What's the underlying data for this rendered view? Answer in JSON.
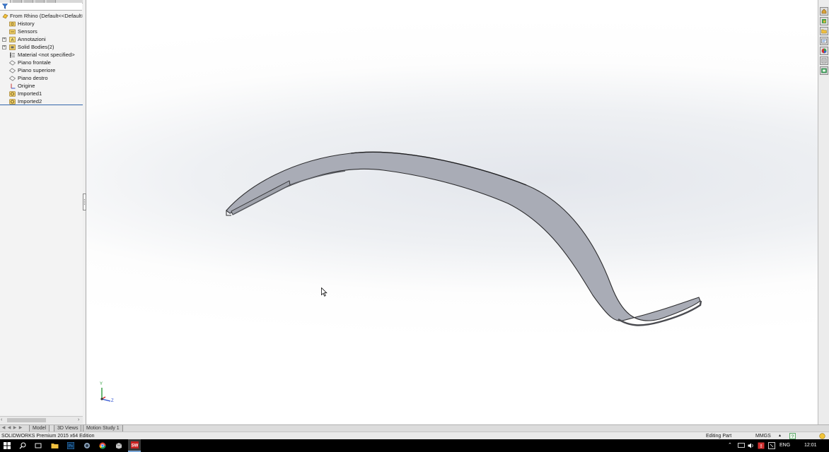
{
  "feature_tree": {
    "root": {
      "label": "From Rhino  (Default<<Default>",
      "icon": "part-icon"
    },
    "items": [
      {
        "label": "History",
        "icon": "history-folder-icon",
        "expandable": false
      },
      {
        "label": "Sensors",
        "icon": "sensors-folder-icon",
        "expandable": false
      },
      {
        "label": "Annotazioni",
        "icon": "annotations-icon",
        "expandable": true
      },
      {
        "label": "Solid Bodies(2)",
        "icon": "solid-bodies-icon",
        "expandable": true
      },
      {
        "label": "Material <not specified>",
        "icon": "material-icon",
        "expandable": false
      },
      {
        "label": "Piano frontale",
        "icon": "plane-icon",
        "expandable": false
      },
      {
        "label": "Piano superiore",
        "icon": "plane-icon",
        "expandable": false
      },
      {
        "label": "Piano destro",
        "icon": "plane-icon",
        "expandable": false
      },
      {
        "label": "Origine",
        "icon": "origin-icon",
        "expandable": false
      },
      {
        "label": "Imported1",
        "icon": "imported-feature-icon",
        "expandable": false
      },
      {
        "label": "Imported2",
        "icon": "imported-feature-icon",
        "expandable": false
      }
    ]
  },
  "bottom_tabs": [
    {
      "label": "Model",
      "active": true
    },
    {
      "label": "3D Views",
      "active": false
    },
    {
      "label": "Motion Study 1",
      "active": false
    }
  ],
  "status_bar": {
    "app_edition": "SOLIDWORKS Premium 2015 x64 Edition",
    "mode": "Editing Part",
    "units": "MMGS",
    "units_caret": "▴"
  },
  "taskbar": {
    "language": "ENG",
    "time": "12:01"
  },
  "triad": {
    "y_label": "Y",
    "z_label": "Z"
  },
  "colors": {
    "part_face": "#a9acb6",
    "part_edge": "#2e2e30",
    "viewport_shadow": "#e3e6ec",
    "tree_selection_line": "#3366aa",
    "taskbar": "#000000"
  }
}
